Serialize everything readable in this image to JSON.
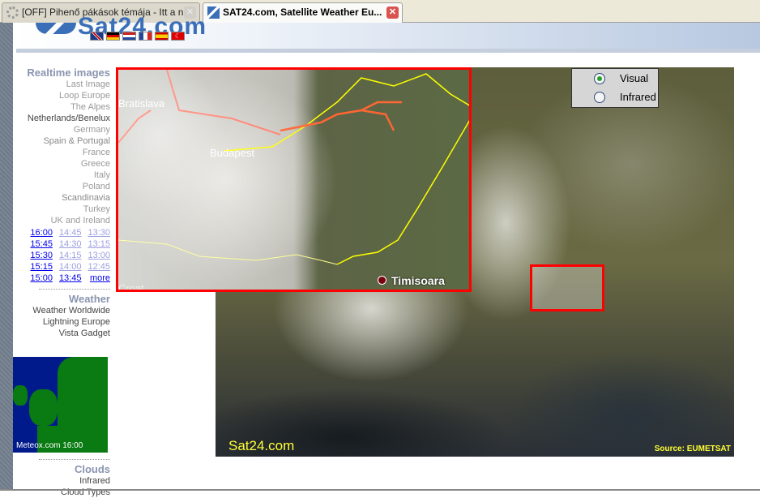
{
  "browser": {
    "tabs": [
      {
        "title": "[OFF] Pihenő pákások témája - Itt a n...",
        "active": false
      },
      {
        "title": "SAT24.com, Satellite Weather Eu...",
        "active": true
      }
    ]
  },
  "header": {
    "logo": "Sat24.com",
    "flags": [
      "uk",
      "de",
      "nl",
      "fr",
      "es",
      "tr"
    ]
  },
  "sidebar": {
    "realtime_heading": "Realtime images",
    "realtime_items": [
      "Last Image",
      "Loop Europe",
      "The Alpes",
      "Netherlands/Benelux",
      "Germany",
      "Spain & Portugal",
      "France",
      "Greece",
      "Italy",
      "Poland",
      "Scandinavia",
      "Turkey",
      "UK and Ireland"
    ],
    "times": [
      "16:00",
      "14:45",
      "13:30",
      "15:45",
      "14:30",
      "13:15",
      "15:30",
      "14:15",
      "13:00",
      "15:15",
      "14:00",
      "12:45",
      "15:00",
      "13:45",
      "more"
    ],
    "weather_heading": "Weather",
    "weather_items": [
      "Weather Worldwide",
      "Lightning Europe",
      "Vista Gadget"
    ],
    "meteox_caption": "Meteox.com 16:00",
    "clouds_heading": "Clouds",
    "clouds_items": [
      "Infrared",
      "Cloud Types"
    ]
  },
  "map": {
    "brand": "Sat24.com",
    "source": "Source: EUMETSAT",
    "mode_options": [
      "Visual",
      "Infrared"
    ],
    "selected_mode": "Visual",
    "popup_cities": [
      "Bratislava",
      "Budapest",
      "Timisoara",
      "Croat"
    ]
  },
  "colors": {
    "link": "#0000ee",
    "heading": "#8a94b0",
    "highlight_box": "#ff0000",
    "brand_text": "#ffff33"
  }
}
